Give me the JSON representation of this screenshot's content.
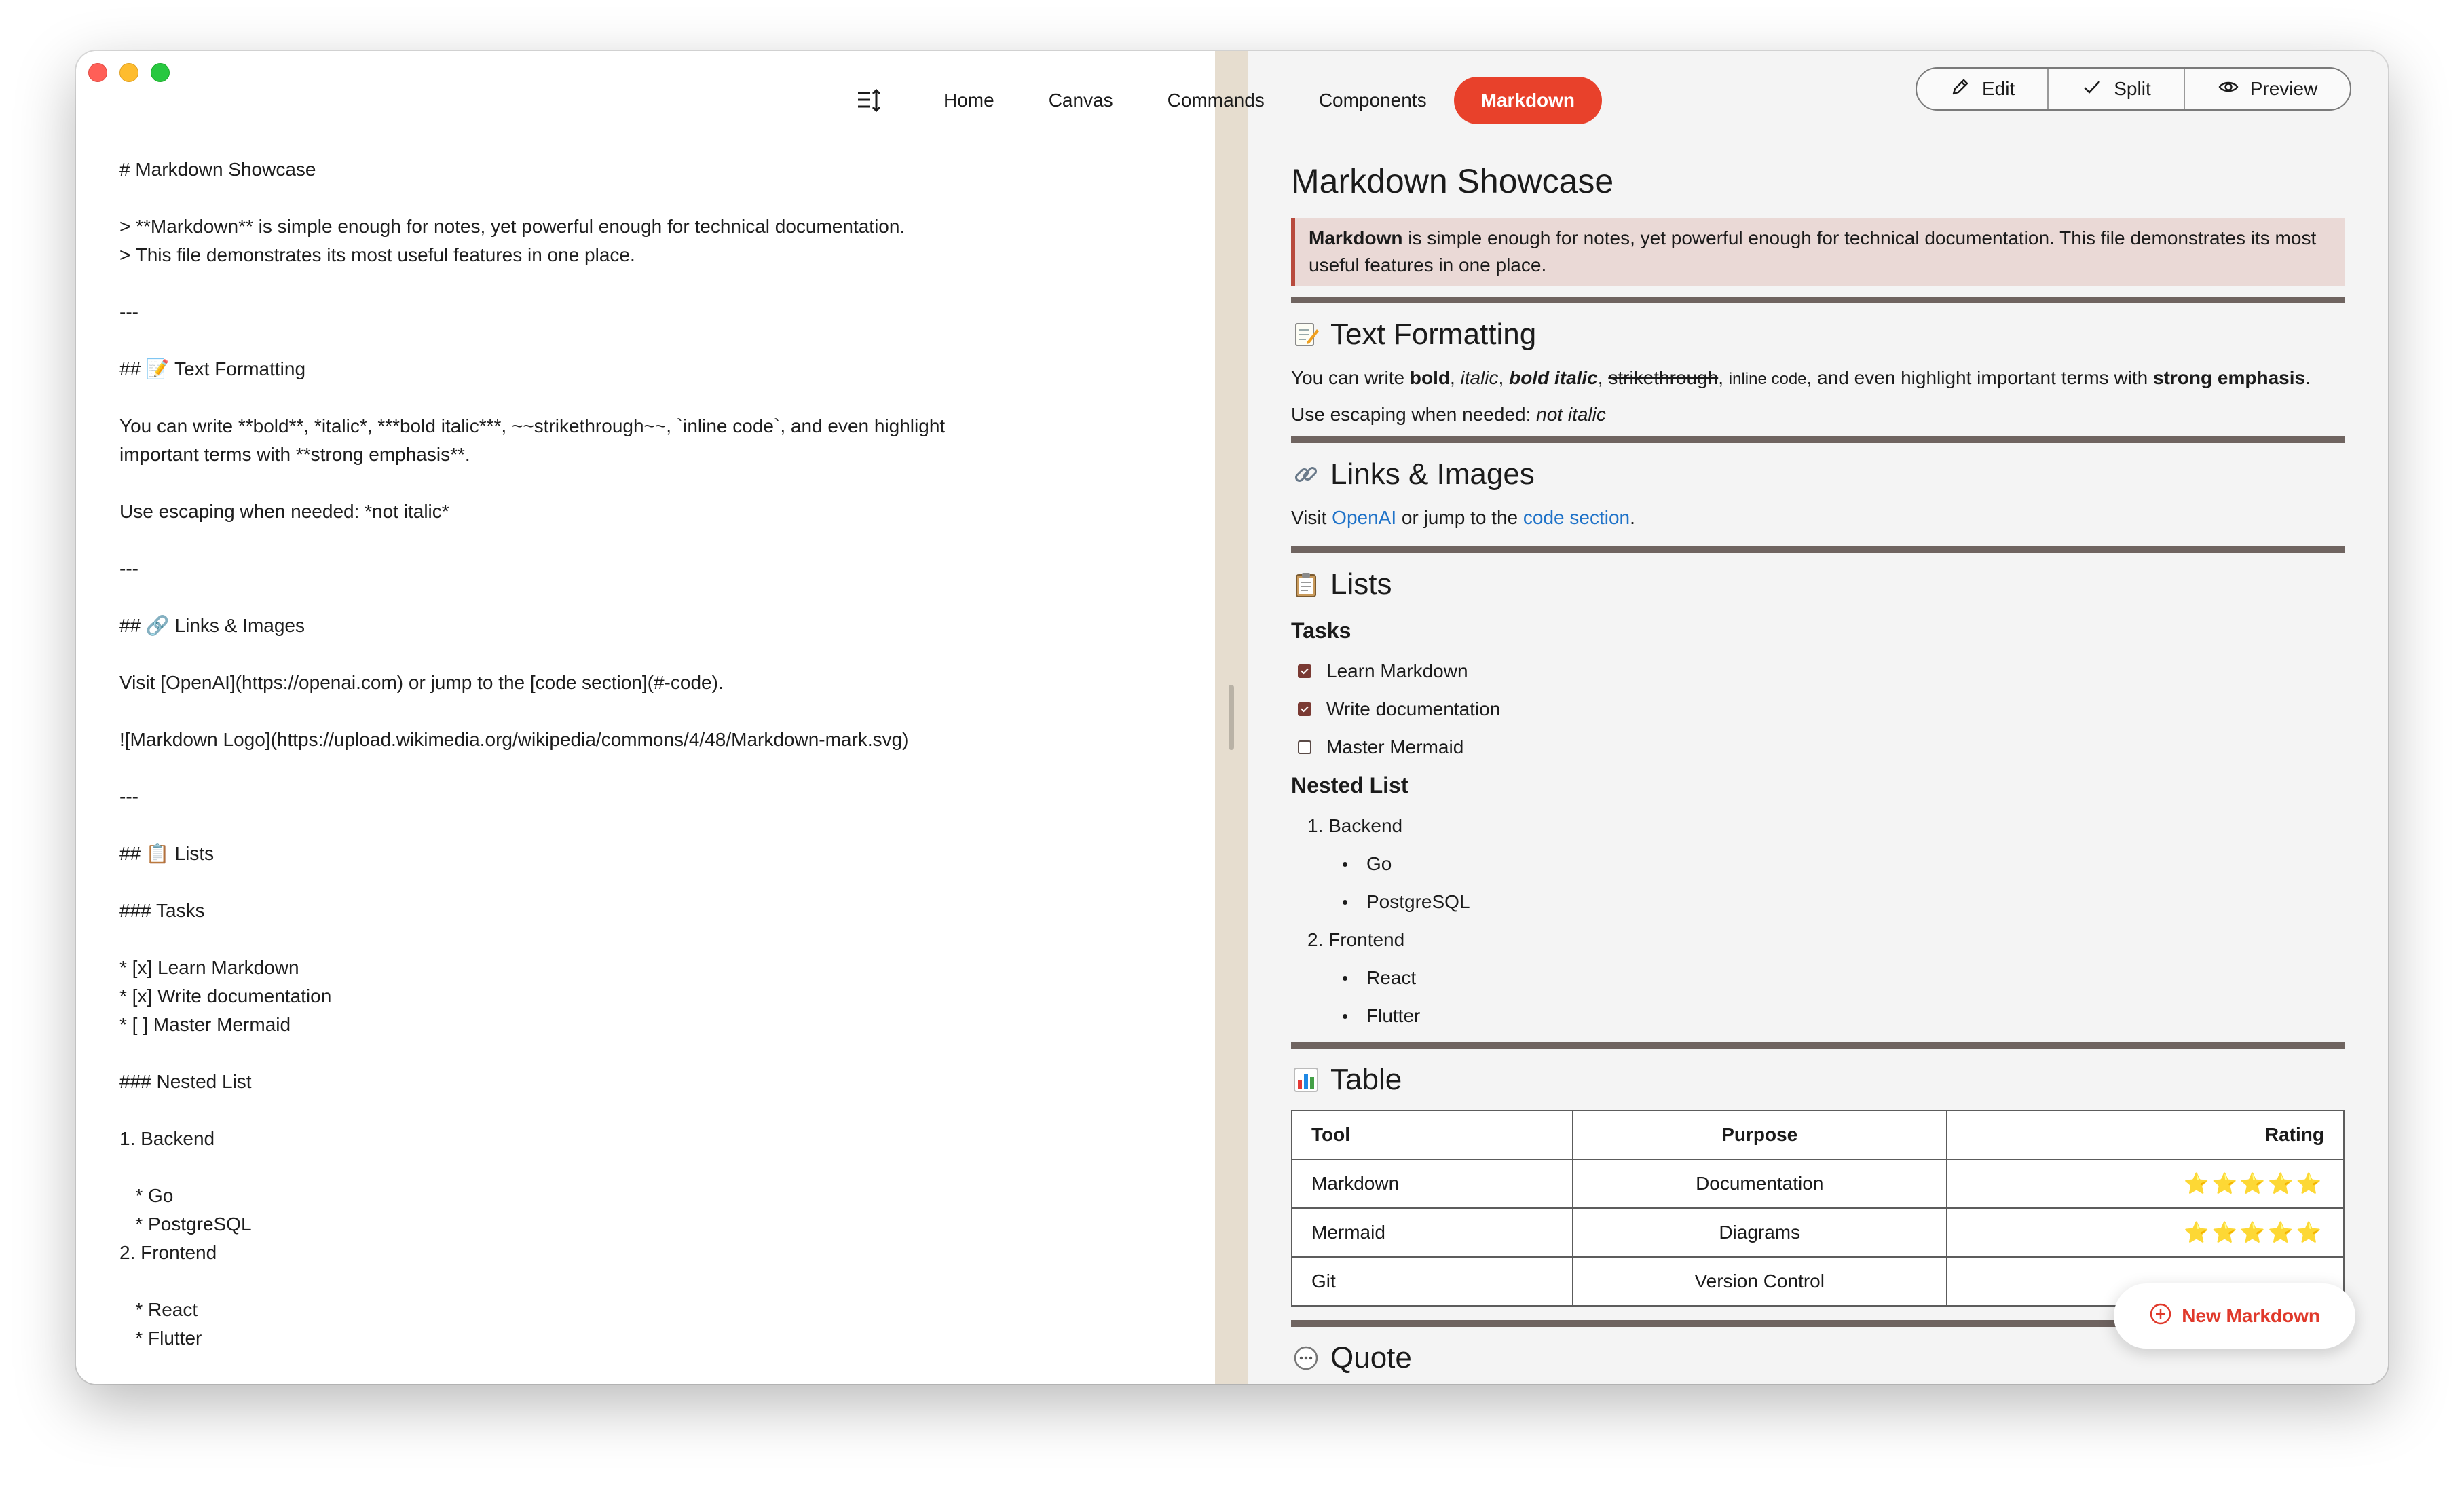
{
  "window": {
    "traffic_lights": [
      "close",
      "minimize",
      "zoom"
    ]
  },
  "nav": {
    "toc_icon": "list-sort-icon",
    "items": [
      "Home",
      "Canvas",
      "Commands",
      "Components",
      "Markdown"
    ],
    "active": "Markdown",
    "accent": "#e8412b"
  },
  "modes": {
    "edit": "Edit",
    "split": "Split",
    "preview": "Preview"
  },
  "editor": {
    "lines": [
      "# Markdown Showcase",
      "",
      "> **Markdown** is simple enough for notes, yet powerful enough for technical documentation.",
      "> This file demonstrates its most useful features in one place.",
      "",
      "---",
      "",
      "## 📝 Text Formatting",
      "",
      "You can write **bold**, *italic*, ***bold italic***, ~~strikethrough~~, `inline code`, and even highlight",
      "important terms with **strong emphasis**.",
      "",
      "Use escaping when needed: *not italic*",
      "",
      "---",
      "",
      "## 🔗 Links & Images",
      "",
      "Visit [OpenAI](https://openai.com) or jump to the [code section](#-code).",
      "",
      "![Markdown Logo](https://upload.wikimedia.org/wikipedia/commons/4/48/Markdown-mark.svg)",
      "",
      "---",
      "",
      "## 📋 Lists",
      "",
      "### Tasks",
      "",
      "* [x] Learn Markdown",
      "* [x] Write documentation",
      "* [ ] Master Mermaid",
      "",
      "### Nested List",
      "",
      "1. Backend",
      "",
      "   * Go",
      "   * PostgreSQL",
      "2. Frontend",
      "",
      "   * React",
      "   * Flutter"
    ]
  },
  "preview": {
    "title": "Markdown Showcase",
    "quote": {
      "bold": "Markdown",
      "rest": " is simple enough for notes, yet powerful enough for technical documentation. This file demonstrates its most useful features in one place."
    },
    "text_formatting": {
      "heading": "Text Formatting",
      "icon": "memo-icon",
      "p1": {
        "a": "You can write ",
        "bold": "bold",
        "b": ", ",
        "italic": "italic",
        "c": ", ",
        "bold_italic": "bold italic",
        "d": ", ",
        "strike": "strikethrough",
        "e": ", ",
        "code": "inline code",
        "f": ", and even highlight important terms with ",
        "strong": "strong emphasis",
        "g": "."
      },
      "p2": {
        "a": "Use escaping when needed: ",
        "em": "not italic"
      }
    },
    "links": {
      "heading": "Links & Images",
      "icon": "link-icon",
      "a": "Visit ",
      "link1": "OpenAI",
      "b": " or jump to the ",
      "link2": "code section",
      "c": "."
    },
    "lists": {
      "heading": "Lists",
      "icon": "clipboard-icon",
      "tasks_heading": "Tasks",
      "tasks": [
        {
          "label": "Learn Markdown",
          "checked": true
        },
        {
          "label": "Write documentation",
          "checked": true
        },
        {
          "label": "Master Mermaid",
          "checked": false
        }
      ],
      "nested_heading": "Nested List",
      "n1": "1. Backend",
      "n1a": "Go",
      "n1b": "PostgreSQL",
      "n2": "2. Frontend",
      "n2a": "React",
      "n2b": "Flutter"
    },
    "table": {
      "heading": "Table",
      "icon": "bar-chart-icon",
      "headers": [
        "Tool",
        "Purpose",
        "Rating"
      ],
      "rows": [
        [
          "Markdown",
          "Documentation",
          "⭐⭐⭐⭐⭐"
        ],
        [
          "Mermaid",
          "Diagrams",
          "⭐⭐⭐⭐⭐"
        ],
        [
          "Git",
          "Version Control",
          ""
        ]
      ]
    },
    "quote_heading": "Quote",
    "quote_icon": "speech-bubble-icon"
  },
  "fab": {
    "label": "New Markdown",
    "icon": "plus-circle-icon"
  }
}
